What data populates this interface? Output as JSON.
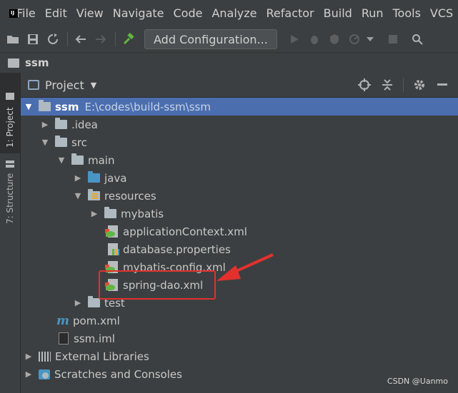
{
  "menubar": {
    "logo_text": "IJ",
    "items": [
      "File",
      "Edit",
      "View",
      "Navigate",
      "Code",
      "Analyze",
      "Refactor",
      "Build",
      "Run",
      "Tools",
      "VCS"
    ]
  },
  "toolbar": {
    "add_configuration_label": "Add Configuration..."
  },
  "breadcrumb": {
    "project": "ssm"
  },
  "side_tabs": {
    "project": "1: Project",
    "structure": "7: Structure"
  },
  "panel": {
    "title": "Project"
  },
  "tree": {
    "root_name": "ssm",
    "root_path": "E:\\codes\\build-ssm\\ssm",
    "idea": ".idea",
    "src": "src",
    "main": "main",
    "java": "java",
    "resources": "resources",
    "mybatis": "mybatis",
    "applicationContext": "applicationContext.xml",
    "database_properties": "database.properties",
    "mybatis_config": "mybatis-config.xml",
    "spring_dao": "spring-dao.xml",
    "test": "test",
    "pom": "pom.xml",
    "ssm_iml": "ssm.iml",
    "external_libraries": "External Libraries",
    "scratches": "Scratches and Consoles"
  },
  "colors": {
    "selection": "#4b6eaf",
    "annotation": "#e2312d"
  },
  "watermark": "CSDN @Uanmo"
}
